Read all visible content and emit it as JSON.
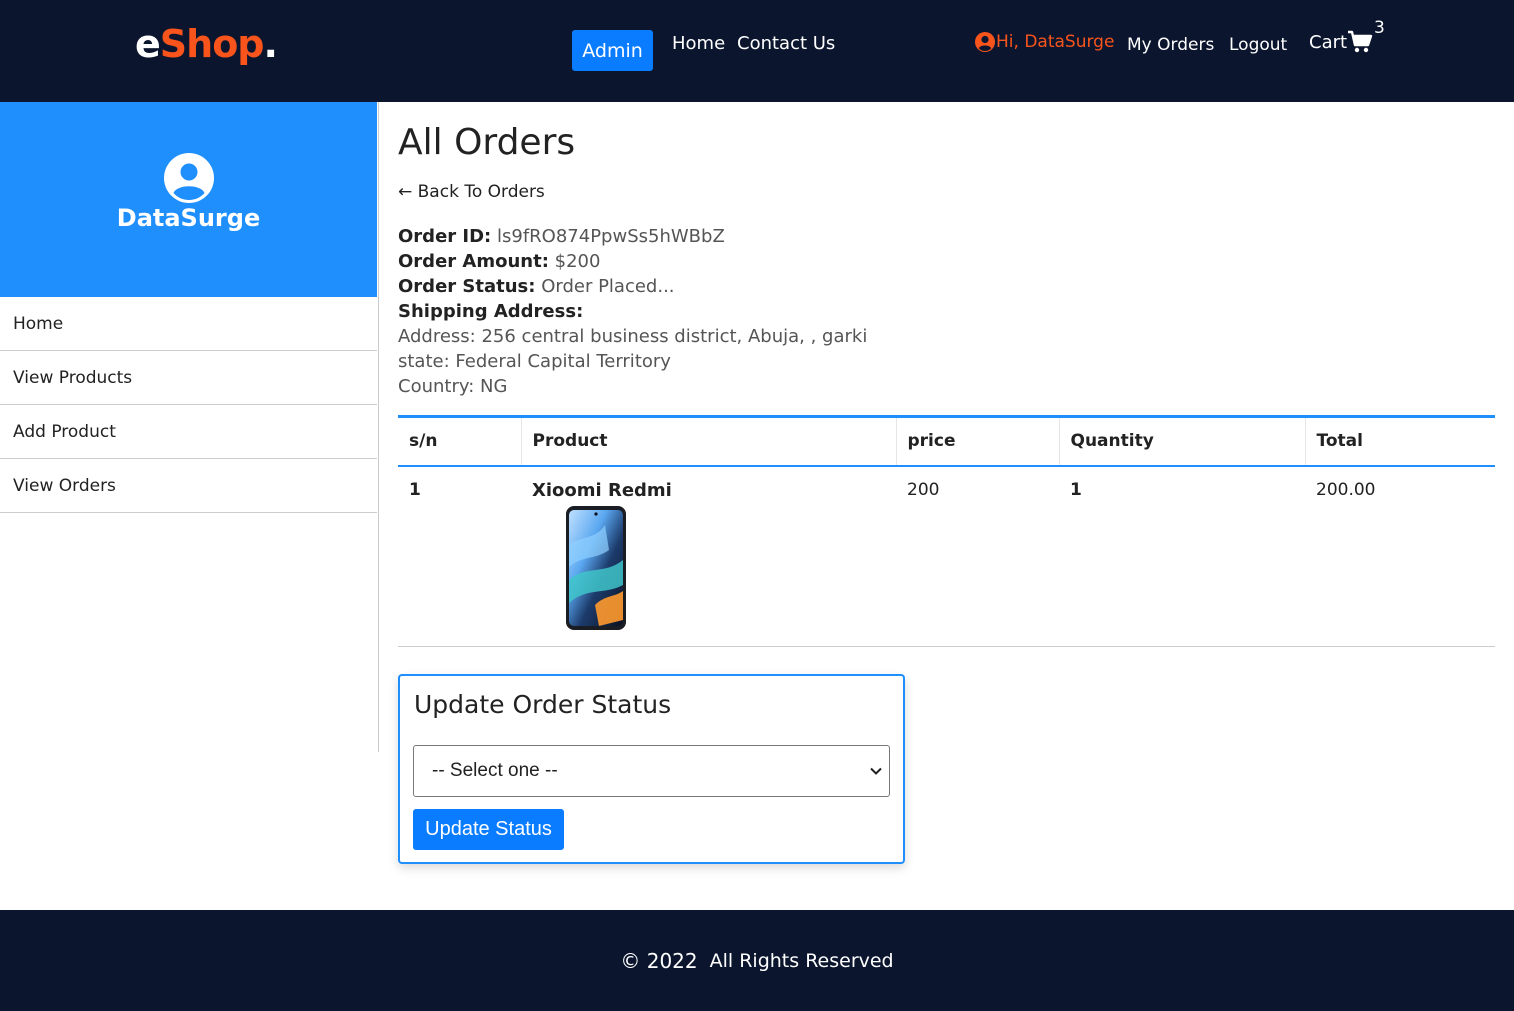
{
  "header": {
    "logo_main": "e",
    "logo_accent": "Shop",
    "logo_dot": ".",
    "admin_label": "Admin",
    "nav": {
      "home": "Home",
      "contact": "Contact Us"
    },
    "greeting": "Hi, DataSurge",
    "my_orders": "My Orders",
    "logout": "Logout",
    "cart_label": "Cart",
    "cart_count": "3"
  },
  "sidebar": {
    "user_name": "DataSurge",
    "items": [
      {
        "label": "Home"
      },
      {
        "label": "View Products"
      },
      {
        "label": "Add Product"
      },
      {
        "label": "View Orders"
      }
    ]
  },
  "main": {
    "title": "All Orders",
    "back_link": "← Back To Orders",
    "order": {
      "id_label": "Order ID:",
      "id": "ls9fRO874PpwSs5hWBbZ",
      "amount_label": "Order Amount:",
      "amount": "$200",
      "status_label": "Order Status:",
      "status": "Order Placed...",
      "shipping_label": "Shipping Address:",
      "address": "Address: 256 central business district, Abuja, , garki",
      "state": "state: Federal Capital Territory",
      "country": "Country: NG"
    },
    "table": {
      "headers": [
        "s/n",
        "Product",
        "price",
        "Quantity",
        "Total"
      ],
      "rows": [
        {
          "sn": "1",
          "product": "Xioomi Redmi",
          "price": "200",
          "quantity": "1",
          "total": "200.00"
        }
      ]
    },
    "update_status": {
      "title": "Update Order Status",
      "select_value": "-- Select one --",
      "button_label": "Update Status"
    }
  },
  "footer": {
    "copyright": "© 2022",
    "rights": "All Rights Reserved"
  },
  "colors": {
    "header_bg": "#0b162e",
    "accent_orange": "#f9541c",
    "primary_blue": "#0a7cff",
    "sidebar_blue": "#1e8ffc"
  }
}
